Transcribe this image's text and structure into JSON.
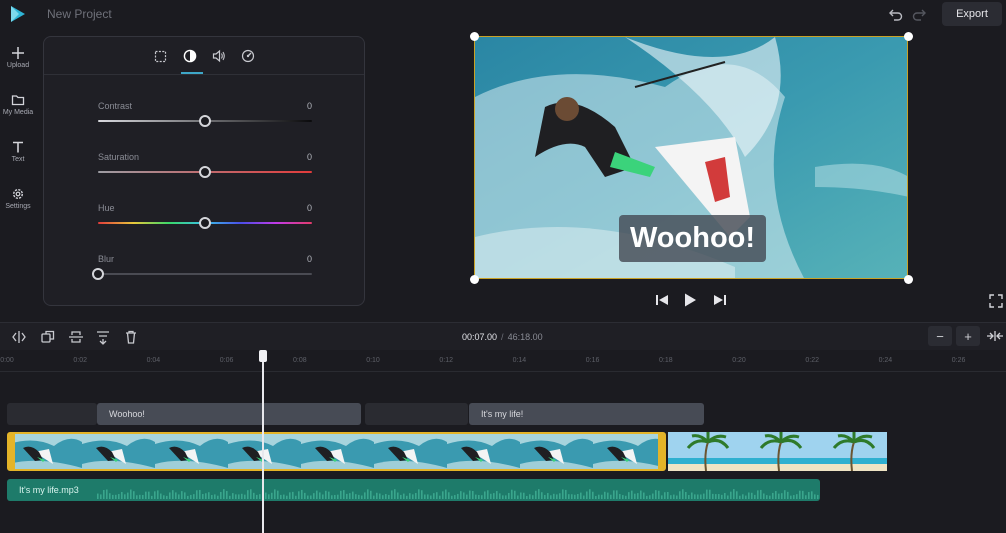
{
  "app": {
    "project_title": "New Project",
    "export_label": "Export"
  },
  "sidebar": {
    "items": [
      {
        "label": "Upload",
        "icon": "plus-icon"
      },
      {
        "label": "My Media",
        "icon": "folder-icon"
      },
      {
        "label": "Text",
        "icon": "text-icon"
      },
      {
        "label": "Settings",
        "icon": "gear-icon"
      }
    ]
  },
  "panel": {
    "tabs": [
      "crop-icon",
      "contrast-icon",
      "volume-icon",
      "speed-icon"
    ],
    "active_tab": 1,
    "sliders": [
      {
        "label": "Contrast",
        "value": "0",
        "level": 0.5
      },
      {
        "label": "Saturation",
        "value": "0",
        "level": 0.5
      },
      {
        "label": "Hue",
        "value": "0",
        "level": 0.5
      },
      {
        "label": "Blur",
        "value": "0",
        "level": 0
      }
    ]
  },
  "preview": {
    "caption": "Woohoo!"
  },
  "timeline": {
    "current_time": "00:07.00",
    "separator": "/",
    "total_time": "46:18.00",
    "ruler_labels": [
      "0:00",
      "0:02",
      "0:04",
      "0:06",
      "0:08",
      "0:10",
      "0:12",
      "0:14",
      "0:16",
      "0:18",
      "0:20",
      "0:22",
      "0:24",
      "0:26"
    ],
    "text_clips": [
      "Woohoo!",
      "It's my life!"
    ],
    "audio_clip": "It's my life.mp3",
    "zoom_out": "−",
    "zoom_in": "+"
  },
  "colors": {
    "accent": "#3ea7c8",
    "selection": "#e4b428",
    "audio": "#1e7b6a",
    "background": "#1b1b20"
  }
}
